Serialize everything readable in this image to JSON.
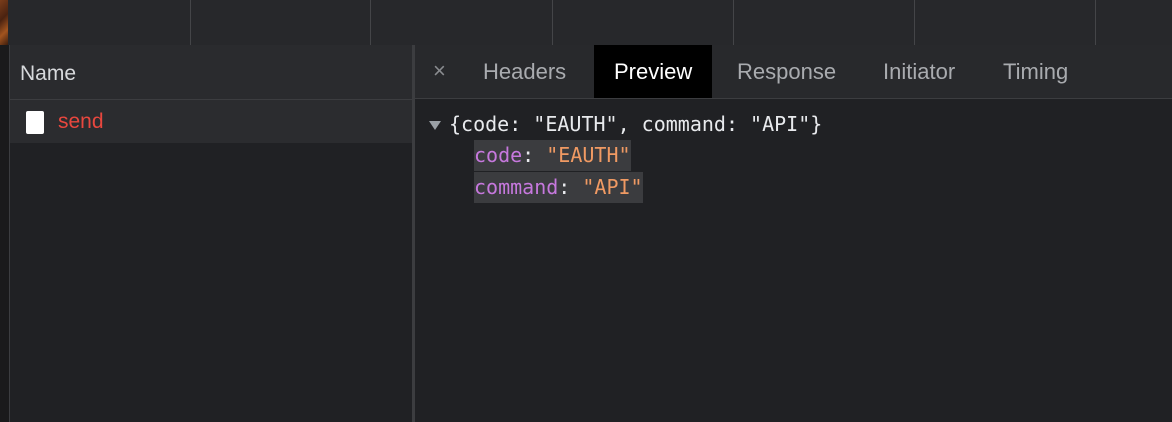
{
  "left_panel": {
    "column_header": "Name",
    "requests": [
      {
        "name": "send",
        "status_color": "#e8473e"
      }
    ]
  },
  "right_panel": {
    "close_icon": "×",
    "tabs": [
      "Headers",
      "Preview",
      "Response",
      "Initiator",
      "Timing"
    ],
    "active_tab": "Preview"
  },
  "preview": {
    "summary": "{code: \"EAUTH\", command: \"API\"}",
    "properties": [
      {
        "key": "code",
        "value": "\"EAUTH\""
      },
      {
        "key": "command",
        "value": "\"API\""
      }
    ]
  },
  "colors": {
    "key": "#c678dd",
    "string": "#f09a63",
    "error": "#e8473e",
    "active_tab_bg": "#000000"
  }
}
